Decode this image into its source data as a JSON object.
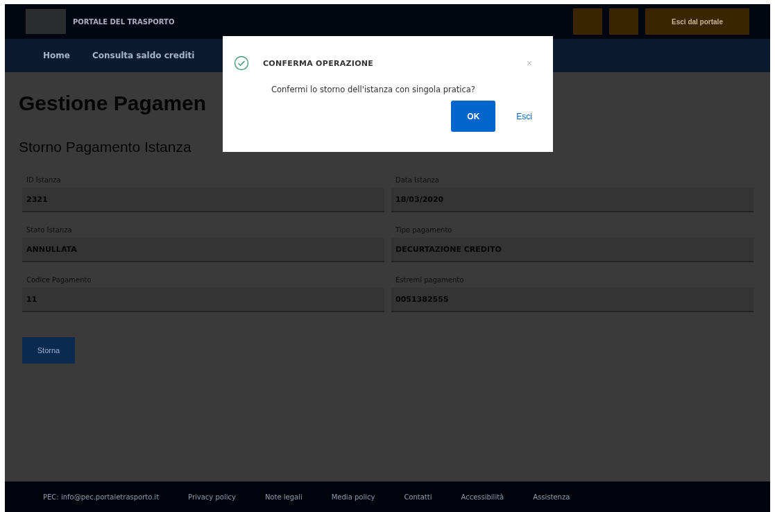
{
  "header": {
    "title": "PORTALE DEL TRASPORTO",
    "buttons": [
      {
        "kind": "icon"
      },
      {
        "kind": "icon"
      },
      {
        "kind": "text",
        "label": "Esci dal portale"
      }
    ]
  },
  "nav": {
    "items": [
      "Home",
      "Consulta saldo crediti"
    ]
  },
  "page": {
    "title": "Gestione Pagamen",
    "subtitle": "Storno Pagamento Istanza",
    "fields": [
      {
        "label": "ID Istanza",
        "value": "2321"
      },
      {
        "label": "Data Istanza",
        "value": "18/03/2020"
      },
      {
        "label": "Stato Istanza",
        "value": "ANNULLATA"
      },
      {
        "label": "Tipo pagamento",
        "value": "DECURTAZIONE CREDITO"
      },
      {
        "label": "Codice Pagamento",
        "value": "11"
      },
      {
        "label": "Estremi pagamento",
        "value": "0051382555"
      }
    ],
    "button": "Storna"
  },
  "footer": {
    "links": [
      "PEC: info@pec.portaletrasporto.it",
      "Privacy policy",
      "Note legali",
      "Media policy",
      "Contatti",
      "Accessibilità",
      "Assistenza"
    ]
  },
  "dialog": {
    "title": "CONFERMA OPERAZIONE",
    "close": "×",
    "message": "Confermi lo storno dell'istanza con singola pratica?",
    "confirm": "OK",
    "cancel": "Esci"
  }
}
